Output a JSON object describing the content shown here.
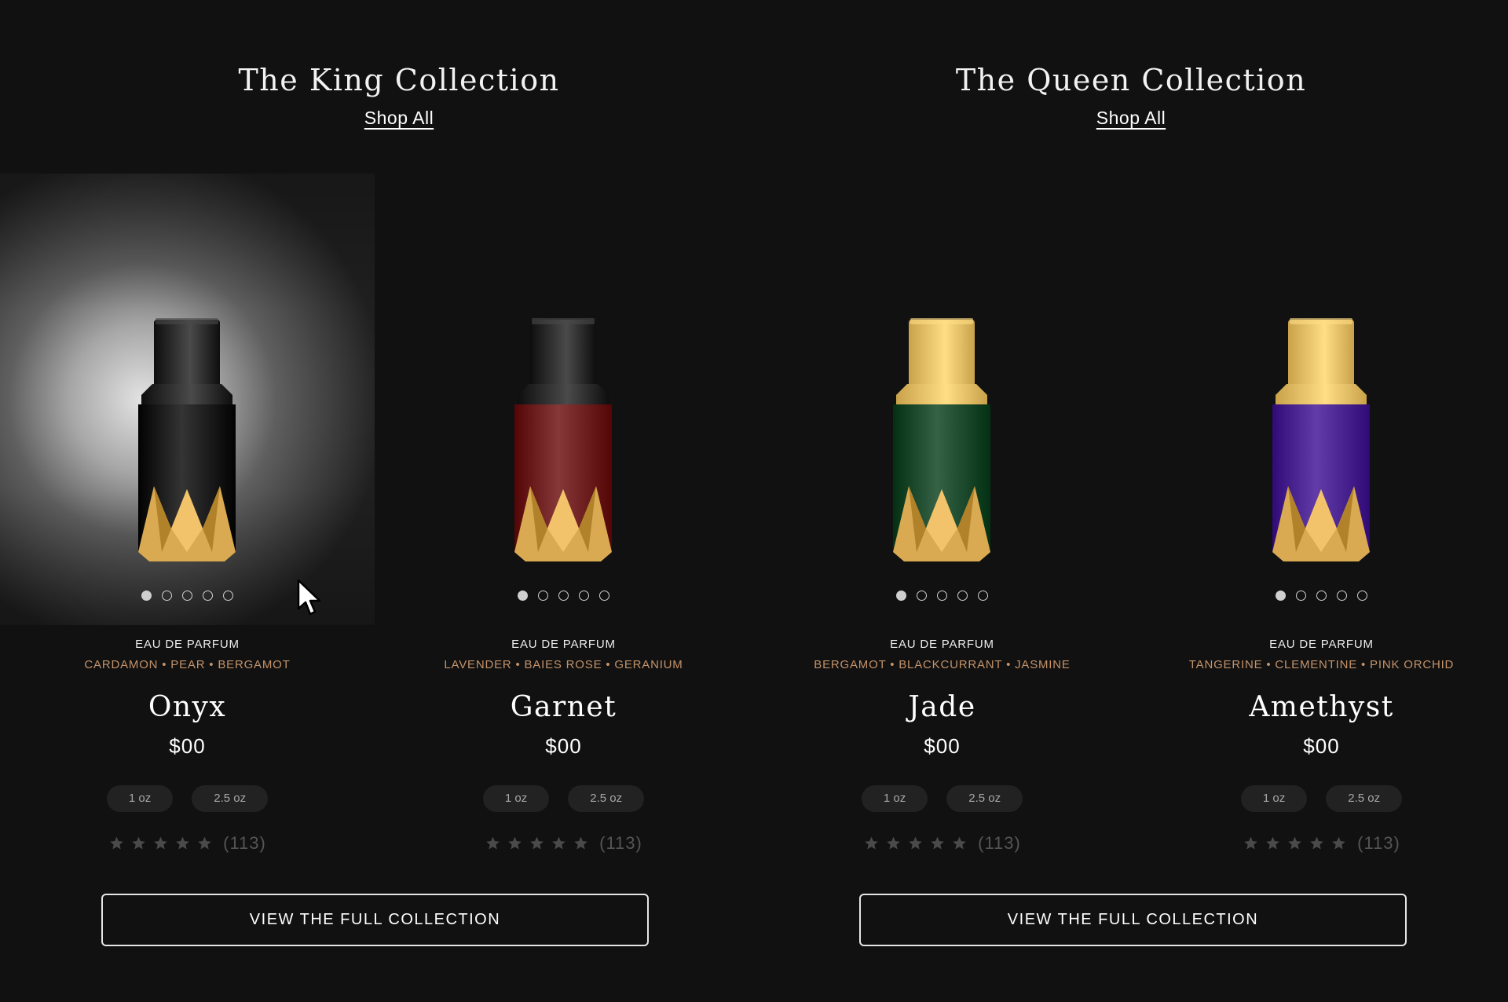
{
  "collections": [
    {
      "title": "The King Collection",
      "shop_all": "Shop All",
      "view_button": "VIEW THE FULL COLLECTION"
    },
    {
      "title": "The Queen Collection",
      "shop_all": "Shop All",
      "view_button": "VIEW THE FULL COLLECTION"
    }
  ],
  "products": [
    {
      "type": "EAU DE PARFUM",
      "notes": "CARDAMON • PEAR • BERGAMOT",
      "name": "Onyx",
      "price": "$00",
      "sizes": [
        "1 oz",
        "2.5 oz"
      ],
      "rating_stars": 5,
      "review_count": "(113)",
      "bottle_color": "#0c0c0c",
      "cap_color": "#0e0e0e",
      "carousel_dots": 5,
      "active_dot": 0
    },
    {
      "type": "EAU DE PARFUM",
      "notes": "LAVENDER • BAIES ROSE • GERANIUM",
      "name": "Garnet",
      "price": "$00",
      "sizes": [
        "1 oz",
        "2.5 oz"
      ],
      "rating_stars": 5,
      "review_count": "(113)",
      "bottle_color": "#5e1010",
      "cap_color": "#0e0e0e",
      "carousel_dots": 5,
      "active_dot": 0
    },
    {
      "type": "EAU DE PARFUM",
      "notes": "BERGAMOT • BLACKCURRANT • JASMINE",
      "name": "Jade",
      "price": "$00",
      "sizes": [
        "1 oz",
        "2.5 oz"
      ],
      "rating_stars": 5,
      "review_count": "(113)",
      "bottle_color": "#0d3a1d",
      "cap_color": "#c9a24a",
      "carousel_dots": 5,
      "active_dot": 0
    },
    {
      "type": "EAU DE PARFUM",
      "notes": "TANGERINE • CLEMENTINE • PINK ORCHID",
      "name": "Amethyst",
      "price": "$00",
      "sizes": [
        "1 oz",
        "2.5 oz"
      ],
      "rating_stars": 5,
      "review_count": "(113)",
      "bottle_color": "#3a1480",
      "cap_color": "#c9a24a",
      "carousel_dots": 5,
      "active_dot": 0
    }
  ],
  "colors": {
    "background": "#111111",
    "notes_accent": "#c4936a",
    "gold_emblem": "#d9aa52",
    "star_empty": "#4a4a4a"
  },
  "icons": {
    "star": "star-icon",
    "cursor": "cursor-arrow-icon"
  }
}
